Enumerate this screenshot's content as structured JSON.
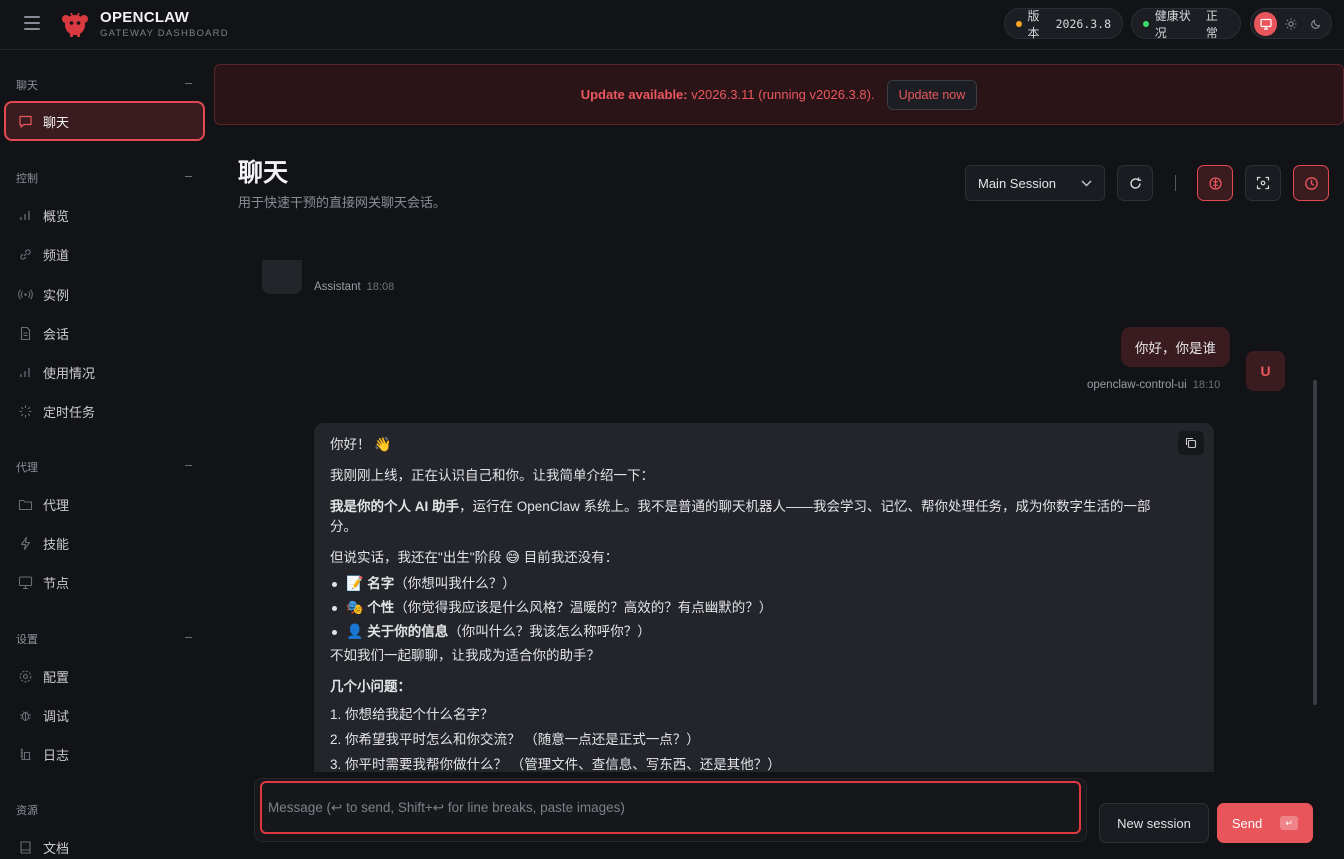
{
  "brand": {
    "name": "OPENCLAW",
    "subtitle": "GATEWAY DASHBOARD"
  },
  "status": {
    "version_label": "版本",
    "version_value": "2026.3.8",
    "health_label": "健康状况",
    "health_value": "正常"
  },
  "sidebar": {
    "sections": [
      {
        "title": "聊天",
        "items": [
          {
            "label": "聊天",
            "icon": "chat-icon",
            "active": true
          }
        ]
      },
      {
        "title": "控制",
        "items": [
          {
            "label": "概览",
            "icon": "bar-chart-icon"
          },
          {
            "label": "频道",
            "icon": "link-icon"
          },
          {
            "label": "实例",
            "icon": "broadcast-icon"
          },
          {
            "label": "会话",
            "icon": "document-icon"
          },
          {
            "label": "使用情况",
            "icon": "bar-chart-icon"
          },
          {
            "label": "定时任务",
            "icon": "loader-icon"
          }
        ]
      },
      {
        "title": "代理",
        "items": [
          {
            "label": "代理",
            "icon": "folder-icon"
          },
          {
            "label": "技能",
            "icon": "lightning-icon"
          },
          {
            "label": "节点",
            "icon": "monitor-icon"
          }
        ]
      },
      {
        "title": "设置",
        "items": [
          {
            "label": "配置",
            "icon": "gear-icon"
          },
          {
            "label": "调试",
            "icon": "bug-icon"
          },
          {
            "label": "日志",
            "icon": "log-icon"
          }
        ]
      },
      {
        "title": "资源",
        "items": [
          {
            "label": "文档",
            "icon": "book-icon"
          }
        ]
      }
    ]
  },
  "banner": {
    "prefix": "Update available:",
    "text": " v2026.3.11 (running v2026.3.8).",
    "button": "Update now"
  },
  "page": {
    "title": "聊天",
    "subtitle": "用于快速干预的直接网关聊天会话。"
  },
  "session": {
    "selected": "Main Session"
  },
  "messages": {
    "assistant_prev": {
      "sender": "Assistant",
      "time": "18:08"
    },
    "user": {
      "text": "你好，你是谁",
      "sender": "openclaw-control-ui",
      "time": "18:10",
      "avatar": "U"
    },
    "assistant": {
      "greeting": "你好！",
      "intro": "我刚刚上线，正在认识自己和你。让我简单介绍一下：",
      "bold1": "我是你的个人 AI 助手",
      "desc_line1": "，运行在 OpenClaw 系统上。我不是普通的聊天机器人——我会学习、记忆、帮你处理任务，成为你数字生活的一部",
      "desc_line2": "分。",
      "birth_a": "但说实话，我还在\"出生\"阶段",
      "birth_b": "目前我还没有：",
      "bullets": [
        {
          "bold": "名字",
          "rest": "（你想叫我什么？）"
        },
        {
          "bold": "个性",
          "rest": "（你觉得我应该是什么风格？温暖的？高效的？有点幽默的？）"
        },
        {
          "bold": "关于你的信息",
          "rest": "（你叫什么？我该怎么称呼你？）"
        }
      ],
      "closing": "不如我们一起聊聊，让我成为适合你的助手？",
      "questions_title": "几个小问题：",
      "questions": [
        "1. 你想给我起个什么名字？",
        "2. 你希望我平时怎么和你交流？ （随意一点还是正式一点？）",
        "3. 你平时需要我帮你做什么？ （管理文件、查信息、写东西、还是其他？）"
      ]
    }
  },
  "composer": {
    "placeholder": "Message (↩ to send, Shift+↩ for line breaks, paste images)",
    "new_session": "New session",
    "send": "Send"
  },
  "colors": {
    "accent": "#e8555b",
    "accent_dark": "#3a1c20",
    "bg": "#121317",
    "online": "#3ddc6b",
    "warn": "#f5a524"
  }
}
